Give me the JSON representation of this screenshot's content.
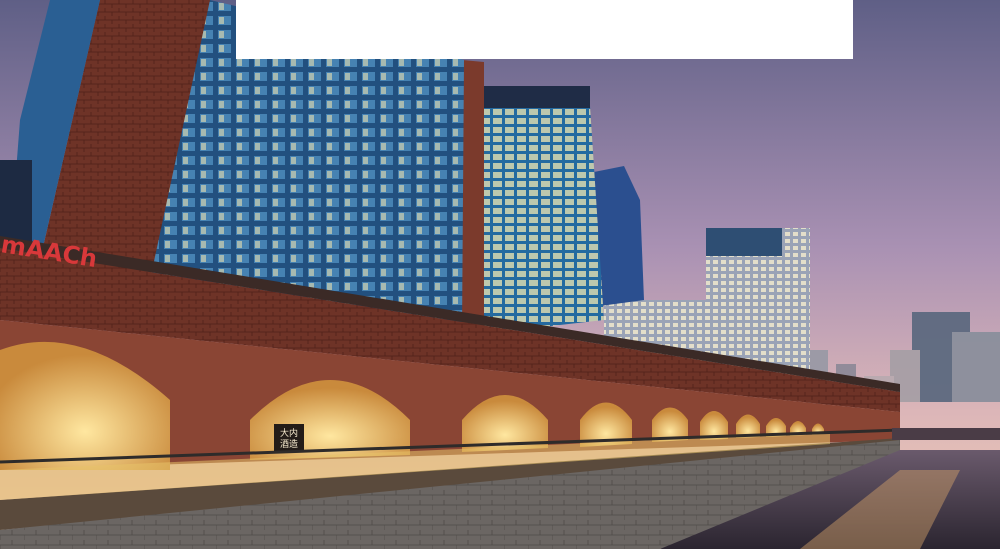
{
  "photo": {
    "building_sign": "mAACh",
    "shop_sign_line1": "大内",
    "shop_sign_line2": "酒造",
    "colors": {
      "sky_top": "#6d6a8c",
      "sky_mid": "#b79ab4",
      "sky_horizon": "#e8c3b6",
      "glass": "#2f6aa0",
      "brick": "#7b3a2c",
      "arch_glow": "#f3cf7a",
      "river": "#3b3540"
    }
  },
  "banner": {
    "text": ""
  }
}
